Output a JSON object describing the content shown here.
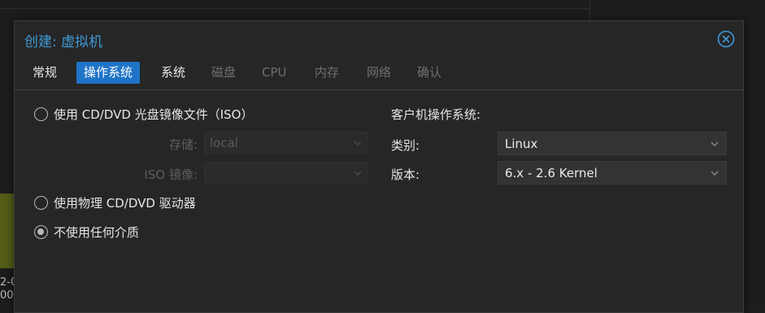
{
  "background": {
    "chart_fragment_text": "2-0\n00"
  },
  "dialog": {
    "title": "创建: 虚拟机",
    "close_icon": "close-circle-icon",
    "accent_color": "#3f9ad8",
    "tabs": [
      {
        "label": "常规",
        "state": "enabled"
      },
      {
        "label": "操作系统",
        "state": "active"
      },
      {
        "label": "系统",
        "state": "enabled"
      },
      {
        "label": "磁盘",
        "state": "disabled"
      },
      {
        "label": "CPU",
        "state": "disabled"
      },
      {
        "label": "内存",
        "state": "disabled"
      },
      {
        "label": "网络",
        "state": "disabled"
      },
      {
        "label": "确认",
        "state": "disabled"
      }
    ],
    "media": {
      "options": [
        {
          "label": "使用 CD/DVD 光盘镜像文件（ISO）",
          "checked": false
        },
        {
          "label": "使用物理 CD/DVD 驱动器",
          "checked": false
        },
        {
          "label": "不使用任何介质",
          "checked": true
        }
      ],
      "storage_label": "存储:",
      "storage_value": "local",
      "iso_label": "ISO 镜像:",
      "iso_value": ""
    },
    "guest_os": {
      "heading": "客户机操作系统:",
      "type_label": "类别:",
      "type_value": "Linux",
      "version_label": "版本:",
      "version_value": "6.x - 2.6 Kernel"
    }
  }
}
